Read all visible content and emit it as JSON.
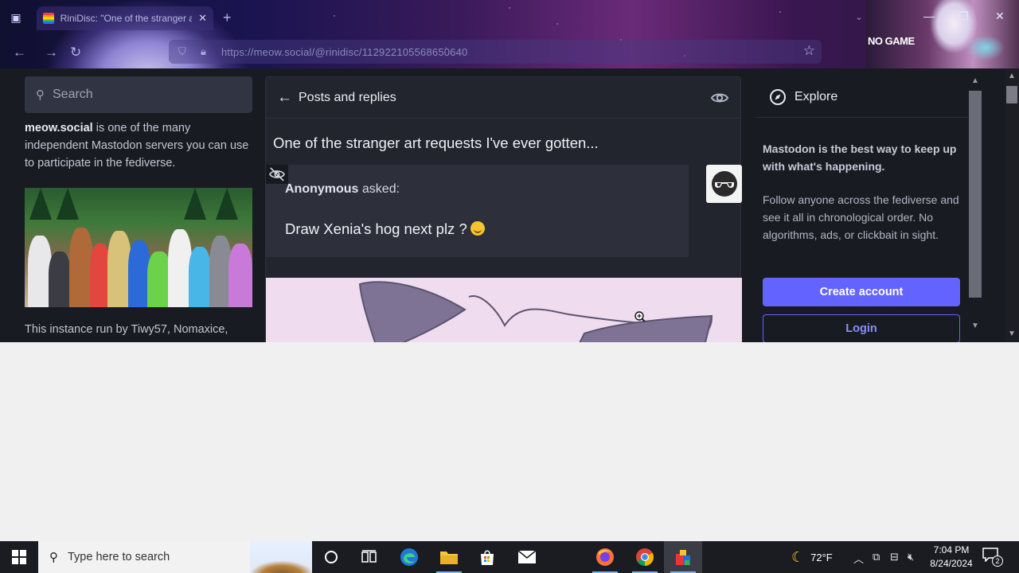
{
  "browser": {
    "tab_title": "RiniDisc: \"One of the stranger a...",
    "url": "https://meow.social/@rinidisc/112922105568650640",
    "theme_logo": "NO GAME"
  },
  "left": {
    "search_placeholder": "Search",
    "server_name": "meow.social",
    "about_rest": " is one of the many independent Mastodon servers you can use to participate in the fediverse.",
    "instance_text": "This instance run by Tiwy57, Nomaxice,"
  },
  "center": {
    "header_title": "Posts and replies",
    "post_title": "One of the stranger art requests I've ever gotten...",
    "asker_name": "Anonymous",
    "asker_suffix": " asked:",
    "question": "Draw Xenia's hog next plz ?"
  },
  "right": {
    "explore_label": "Explore",
    "promo_strong": "Mastodon is the best way to keep up with what's happening.",
    "promo_text": "Follow anyone across the fediverse and see it all in chronological order. No algorithms, ads, or clickbait in sight.",
    "create_account": "Create account",
    "login": "Login"
  },
  "taskbar": {
    "search_placeholder": "Type here to search",
    "weather_temp": "72°F",
    "time": "7:04 PM",
    "date": "8/24/2024",
    "notification_count": "2"
  },
  "colors": {
    "accent": "#6364ff",
    "page_bg": "#191b22",
    "column_bg": "#22242e"
  },
  "icons": [
    "search-icon",
    "back-arrow-icon",
    "eye-icon",
    "eye-slash-icon",
    "compass-icon",
    "zoom-in-cursor-icon",
    "windows-start-icon",
    "cortana-icon",
    "task-view-icon",
    "edge-icon",
    "file-explorer-icon",
    "store-icon",
    "mail-icon",
    "firefox-icon",
    "chrome-icon",
    "moon-weather-icon",
    "notification-icon"
  ]
}
